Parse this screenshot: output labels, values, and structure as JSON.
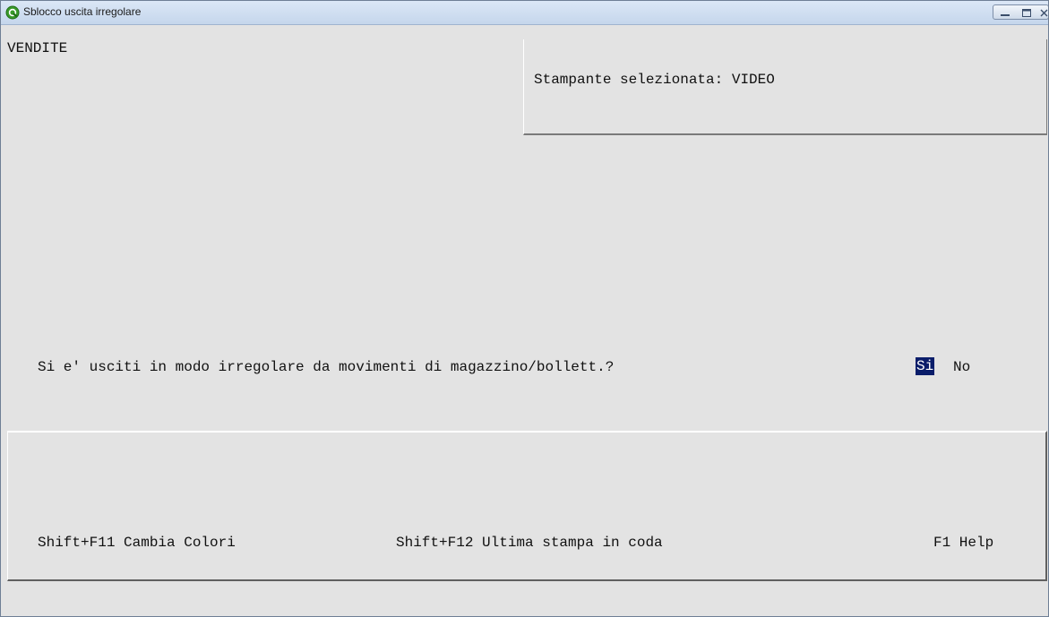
{
  "window": {
    "title": "Sblocco uscita irregolare",
    "icon": "app-q-icon",
    "controls": [
      "minimize-icon",
      "maximize-icon",
      "close-icon"
    ]
  },
  "header": {
    "module": "VENDITE",
    "printer_label": "Stampante selezionata: VIDEO"
  },
  "dialog": {
    "question": "Si e' usciti in modo irregolare da movimenti di magazzino/bollett.?",
    "options": [
      "Si",
      "No"
    ],
    "selected": "Si"
  },
  "footer": {
    "keys": [
      "Shift+F11 Cambia Colori",
      "Shift+F12 Ultima stampa in coda",
      "F1 Help"
    ]
  },
  "colors": {
    "background": "#e3e3e3",
    "highlight": "#0a1d6a",
    "highlight_text": "#ffffff"
  }
}
